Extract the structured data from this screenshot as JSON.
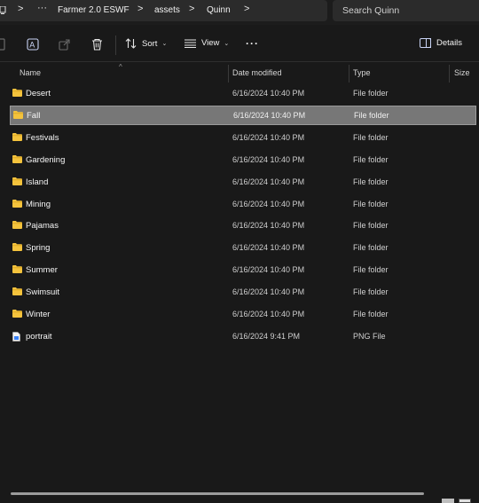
{
  "address": {
    "segments": [
      "Farmer 2.0 ESWF",
      "assets",
      "Quinn"
    ],
    "overflow_label": "···",
    "separator": ">"
  },
  "search": {
    "placeholder": "Search Quinn"
  },
  "toolbar": {
    "sort_label": "Sort",
    "view_label": "View",
    "more_label": "···",
    "details_label": "Details"
  },
  "columns": {
    "name": "Name",
    "date_modified": "Date modified",
    "type": "Type",
    "size": "Size"
  },
  "rows": [
    {
      "name": "Desert",
      "date": "6/16/2024 10:40 PM",
      "type": "File folder",
      "icon": "folder-icon"
    },
    {
      "name": "Fall",
      "date": "6/16/2024 10:40 PM",
      "type": "File folder",
      "icon": "folder-icon",
      "selected": true
    },
    {
      "name": "Festivals",
      "date": "6/16/2024 10:40 PM",
      "type": "File folder",
      "icon": "folder-icon"
    },
    {
      "name": "Gardening",
      "date": "6/16/2024 10:40 PM",
      "type": "File folder",
      "icon": "folder-icon"
    },
    {
      "name": "Island",
      "date": "6/16/2024 10:40 PM",
      "type": "File folder",
      "icon": "folder-icon"
    },
    {
      "name": "Mining",
      "date": "6/16/2024 10:40 PM",
      "type": "File folder",
      "icon": "folder-icon"
    },
    {
      "name": "Pajamas",
      "date": "6/16/2024 10:40 PM",
      "type": "File folder",
      "icon": "folder-icon"
    },
    {
      "name": "Spring",
      "date": "6/16/2024 10:40 PM",
      "type": "File folder",
      "icon": "folder-icon"
    },
    {
      "name": "Summer",
      "date": "6/16/2024 10:40 PM",
      "type": "File folder",
      "icon": "folder-icon"
    },
    {
      "name": "Swimsuit",
      "date": "6/16/2024 10:40 PM",
      "type": "File folder",
      "icon": "folder-icon"
    },
    {
      "name": "Winter",
      "date": "6/16/2024 10:40 PM",
      "type": "File folder",
      "icon": "folder-icon"
    },
    {
      "name": "portrait",
      "date": "6/16/2024 9:41 PM",
      "type": "PNG File",
      "icon": "png-file-icon"
    }
  ],
  "colors": {
    "background": "#191919",
    "folder": "#f4c33d",
    "selection": "#777777",
    "png_icon": "#3b82f6"
  }
}
